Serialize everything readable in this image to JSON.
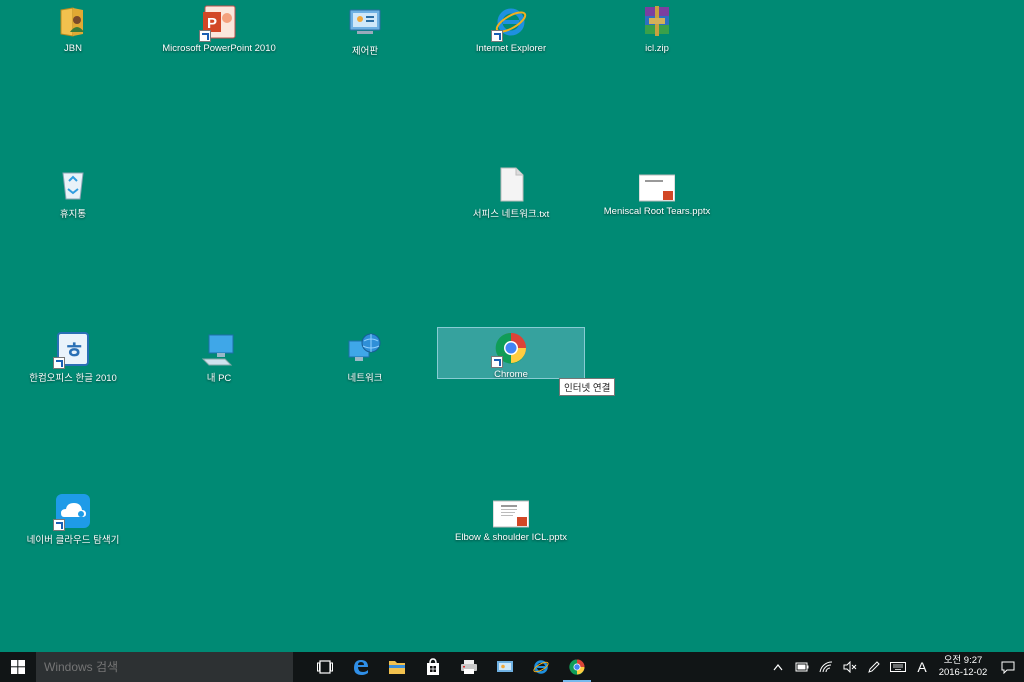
{
  "desktop": {
    "icons": [
      {
        "name": "JBN"
      },
      {
        "name": "Microsoft PowerPoint 2010"
      },
      {
        "name": "제어판"
      },
      {
        "name": "Internet Explorer"
      },
      {
        "name": "icl.zip"
      },
      {
        "name": "휴지통"
      },
      {
        "name": "서피스 네트워크.txt"
      },
      {
        "name": "Meniscal Root Tears.pptx"
      },
      {
        "name": "한컴오피스 한글 2010"
      },
      {
        "name": "내 PC"
      },
      {
        "name": "네트워크"
      },
      {
        "name": "Chrome"
      },
      {
        "name": "네이버 클라우드 탐색기"
      },
      {
        "name": "Elbow & shoulder ICL.pptx"
      }
    ],
    "tooltip": "인터넷 연결"
  },
  "taskbar": {
    "search_placeholder": "Windows 검색",
    "clock": {
      "time": "오전 9:27",
      "date": "2016-12-02"
    },
    "ime": "A"
  },
  "colors": {
    "desktop": "#008a74",
    "taskbar": "#111516",
    "accent": "#76b9ed"
  }
}
